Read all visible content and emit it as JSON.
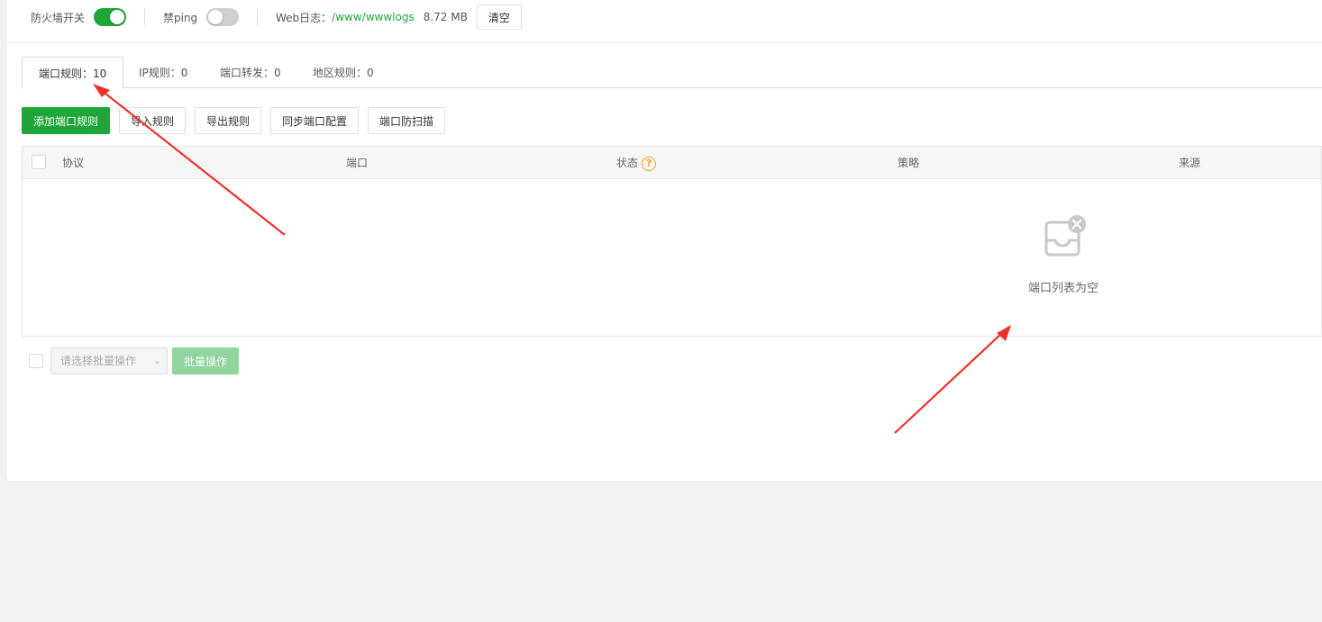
{
  "topbar": {
    "firewall_label": "防火墙开关",
    "firewall_on": true,
    "ping_label": "禁ping",
    "ping_on": false,
    "weblog_label": "Web日志：",
    "weblog_path": "/www/wwwlogs",
    "weblog_size": "8.72 MB",
    "clear_label": "清空"
  },
  "tabs": [
    {
      "label": "端口规则：10",
      "active": true
    },
    {
      "label": "IP规则：0",
      "active": false
    },
    {
      "label": "端口转发：0",
      "active": false
    },
    {
      "label": "地区规则：0",
      "active": false
    }
  ],
  "actions": {
    "add": "添加端口规则",
    "import": "导入规则",
    "export": "导出规则",
    "sync": "同步端口配置",
    "scan": "端口防扫描"
  },
  "table": {
    "columns": [
      "协议",
      "端口",
      "状态",
      "策略",
      "来源"
    ],
    "status_help_icon": "question-circle-icon",
    "rows": [],
    "empty_text": "端口列表为空"
  },
  "batch": {
    "select_placeholder": "请选择批量操作",
    "apply_label": "批量操作"
  },
  "colors": {
    "accent": "#20a53a",
    "annotation_arrow": "#f0312a"
  }
}
